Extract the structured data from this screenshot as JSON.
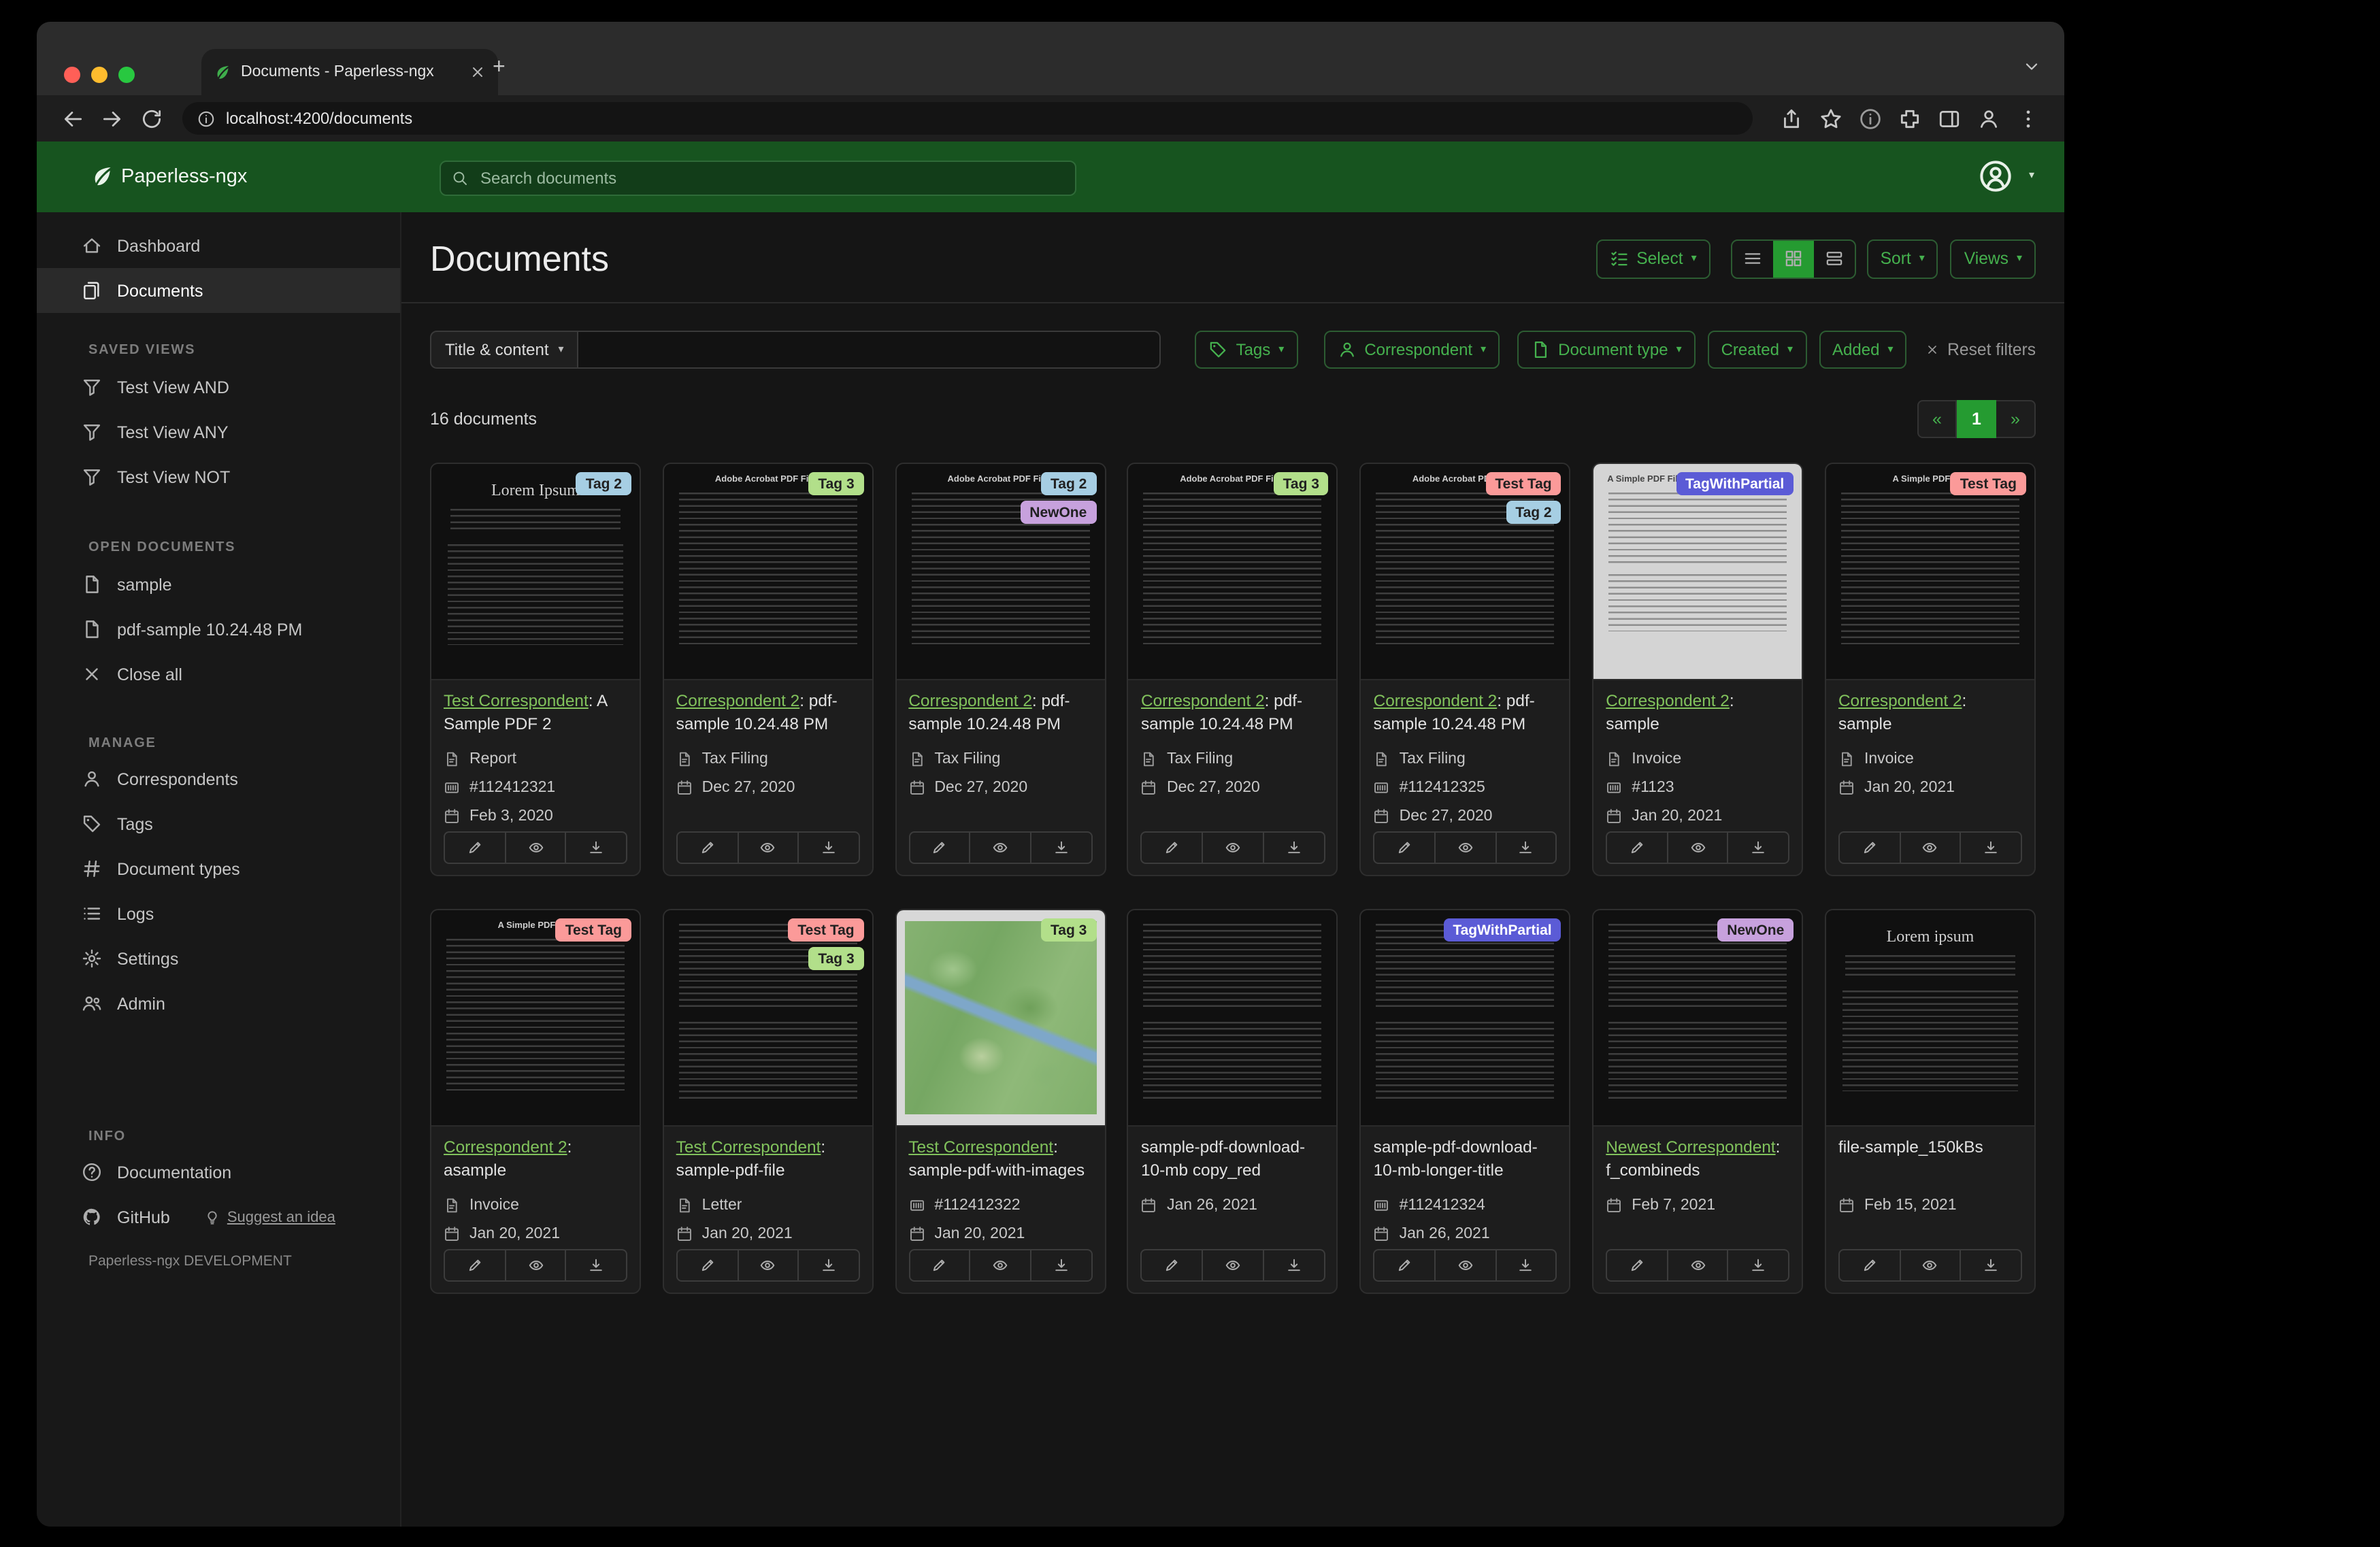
{
  "window": {
    "tab_title": "Documents - Paperless-ngx",
    "url": "localhost:4200/documents"
  },
  "header": {
    "app_name": "Paperless-ngx",
    "search_placeholder": "Search documents"
  },
  "sidebar": {
    "dashboard": "Dashboard",
    "documents": "Documents",
    "saved_views_title": "SAVED VIEWS",
    "saved_views": [
      "Test View AND",
      "Test View ANY",
      "Test View NOT"
    ],
    "open_documents_title": "OPEN DOCUMENTS",
    "open_documents": [
      "sample",
      "pdf-sample 10.24.48 PM"
    ],
    "close_all": "Close all",
    "manage_title": "MANAGE",
    "manage": [
      "Correspondents",
      "Tags",
      "Document types",
      "Logs",
      "Settings",
      "Admin"
    ],
    "info_title": "INFO",
    "documentation": "Documentation",
    "github": "GitHub",
    "suggest": "Suggest an idea",
    "footer": "Paperless-ngx DEVELOPMENT"
  },
  "page": {
    "title": "Documents",
    "select_label": "Select",
    "sort_label": "Sort",
    "views_label": "Views",
    "filter_field": "Title & content",
    "filter_tags": "Tags",
    "filter_correspondent": "Correspondent",
    "filter_document_type": "Document type",
    "filter_created": "Created",
    "filter_added": "Added",
    "reset_filters": "Reset filters",
    "count_text": "16 documents",
    "pagination": {
      "prev": "«",
      "page": "1",
      "next": "»"
    }
  },
  "colors": {
    "header_green": "#17541f",
    "accent_green": "#45b14e",
    "active_green": "#259b31",
    "link_green": "#81c25c"
  },
  "tag_colors": {
    "Tag 2": {
      "bg": "#a6cee3",
      "fg": "#212121"
    },
    "Tag 3": {
      "bg": "#b2df8a",
      "fg": "#212121"
    },
    "Test Tag": {
      "bg": "#fb9a99",
      "fg": "#212121"
    },
    "NewOne": {
      "bg": "#c7a1dd",
      "fg": "#212121"
    },
    "TagWithPartial": {
      "bg": "#5b5bd6",
      "fg": "#ffffff"
    }
  },
  "cards": [
    {
      "tags": [
        "Tag 2"
      ],
      "thumb": {
        "variant": "serif",
        "heading": "Lorem Ipsum"
      },
      "link": "Test Correspondent",
      "rest": ": A Sample PDF 2",
      "meta": [
        {
          "icon": "file",
          "text": "Report"
        },
        {
          "icon": "asn",
          "text": "#112412321"
        },
        {
          "icon": "cal",
          "text": "Feb 3, 2020"
        }
      ]
    },
    {
      "tags": [
        "Tag 3"
      ],
      "thumb": {
        "variant": "small",
        "heading": "Adobe Acrobat PDF Files"
      },
      "link": "Correspondent 2",
      "rest": ": pdf-sample 10.24.48 PM",
      "meta": [
        {
          "icon": "file",
          "text": "Tax Filing"
        },
        {
          "icon": "cal",
          "text": "Dec 27, 2020"
        }
      ]
    },
    {
      "tags": [
        "Tag 2",
        "NewOne"
      ],
      "thumb": {
        "variant": "small",
        "heading": "Adobe Acrobat PDF Files"
      },
      "link": "Correspondent 2",
      "rest": ": pdf-sample 10.24.48 PM",
      "meta": [
        {
          "icon": "file",
          "text": "Tax Filing"
        },
        {
          "icon": "cal",
          "text": "Dec 27, 2020"
        }
      ]
    },
    {
      "tags": [
        "Tag 3"
      ],
      "thumb": {
        "variant": "small",
        "heading": "Adobe Acrobat PDF Files"
      },
      "link": "Correspondent 2",
      "rest": ": pdf-sample 10.24.48 PM",
      "meta": [
        {
          "icon": "file",
          "text": "Tax Filing"
        },
        {
          "icon": "cal",
          "text": "Dec 27, 2020"
        }
      ]
    },
    {
      "tags": [
        "Test Tag",
        "Tag 2"
      ],
      "thumb": {
        "variant": "small",
        "heading": "Adobe Acrobat PDF Files"
      },
      "link": "Correspondent 2",
      "rest": ": pdf-sample 10.24.48 PM",
      "meta": [
        {
          "icon": "file",
          "text": "Tax Filing"
        },
        {
          "icon": "asn",
          "text": "#112412325"
        },
        {
          "icon": "cal",
          "text": "Dec 27, 2020"
        }
      ]
    },
    {
      "tags": [
        "TagWithPartial"
      ],
      "thumb": {
        "variant": "light",
        "heading": "A Simple PDF File"
      },
      "link": "Correspondent 2",
      "rest": ": sample",
      "meta": [
        {
          "icon": "file",
          "text": "Invoice"
        },
        {
          "icon": "asn",
          "text": "#1123"
        },
        {
          "icon": "cal",
          "text": "Jan 20, 2021"
        }
      ]
    },
    {
      "tags": [
        "Test Tag"
      ],
      "thumb": {
        "variant": "small",
        "heading": "A Simple PDF File"
      },
      "link": "Correspondent 2",
      "rest": ": sample",
      "meta": [
        {
          "icon": "file",
          "text": "Invoice"
        },
        {
          "icon": "cal",
          "text": "Jan 20, 2021"
        }
      ]
    },
    {
      "tags": [
        "Test Tag"
      ],
      "thumb": {
        "variant": "small",
        "heading": "A Simple PDF File"
      },
      "link": "Correspondent 2",
      "rest": ": asample",
      "meta": [
        {
          "icon": "file",
          "text": "Invoice"
        },
        {
          "icon": "cal",
          "text": "Jan 20, 2021"
        }
      ]
    },
    {
      "tags": [
        "Test Tag",
        "Tag 3"
      ],
      "thumb": {
        "variant": "plain",
        "heading": ""
      },
      "link": "Test Correspondent",
      "rest": ": sample-pdf-file",
      "meta": [
        {
          "icon": "file",
          "text": "Letter"
        },
        {
          "icon": "cal",
          "text": "Jan 20, 2021"
        }
      ]
    },
    {
      "tags": [
        "Tag 3"
      ],
      "thumb": {
        "variant": "map",
        "heading": ""
      },
      "link": "Test Correspondent",
      "rest": ": sample-pdf-with-images",
      "meta": [
        {
          "icon": "asn",
          "text": "#112412322"
        },
        {
          "icon": "cal",
          "text": "Jan 20, 2021"
        }
      ]
    },
    {
      "tags": [],
      "thumb": {
        "variant": "plain",
        "heading": ""
      },
      "link": null,
      "rest": "sample-pdf-download-10-mb copy_red",
      "meta": [
        {
          "icon": "cal",
          "text": "Jan 26, 2021"
        }
      ]
    },
    {
      "tags": [
        "TagWithPartial"
      ],
      "thumb": {
        "variant": "plain",
        "heading": ""
      },
      "link": null,
      "rest": "sample-pdf-download-10-mb-longer-title",
      "meta": [
        {
          "icon": "asn",
          "text": "#112412324"
        },
        {
          "icon": "cal",
          "text": "Jan 26, 2021"
        }
      ]
    },
    {
      "tags": [
        "NewOne"
      ],
      "thumb": {
        "variant": "plain",
        "heading": ""
      },
      "link": "Newest Correspondent",
      "rest": ": f_combineds",
      "meta": [
        {
          "icon": "cal",
          "text": "Feb 7, 2021"
        }
      ]
    },
    {
      "tags": [],
      "thumb": {
        "variant": "serif",
        "heading": "Lorem ipsum"
      },
      "link": null,
      "rest": "file-sample_150kBs",
      "meta": [
        {
          "icon": "cal",
          "text": "Feb 15, 2021"
        }
      ]
    }
  ]
}
